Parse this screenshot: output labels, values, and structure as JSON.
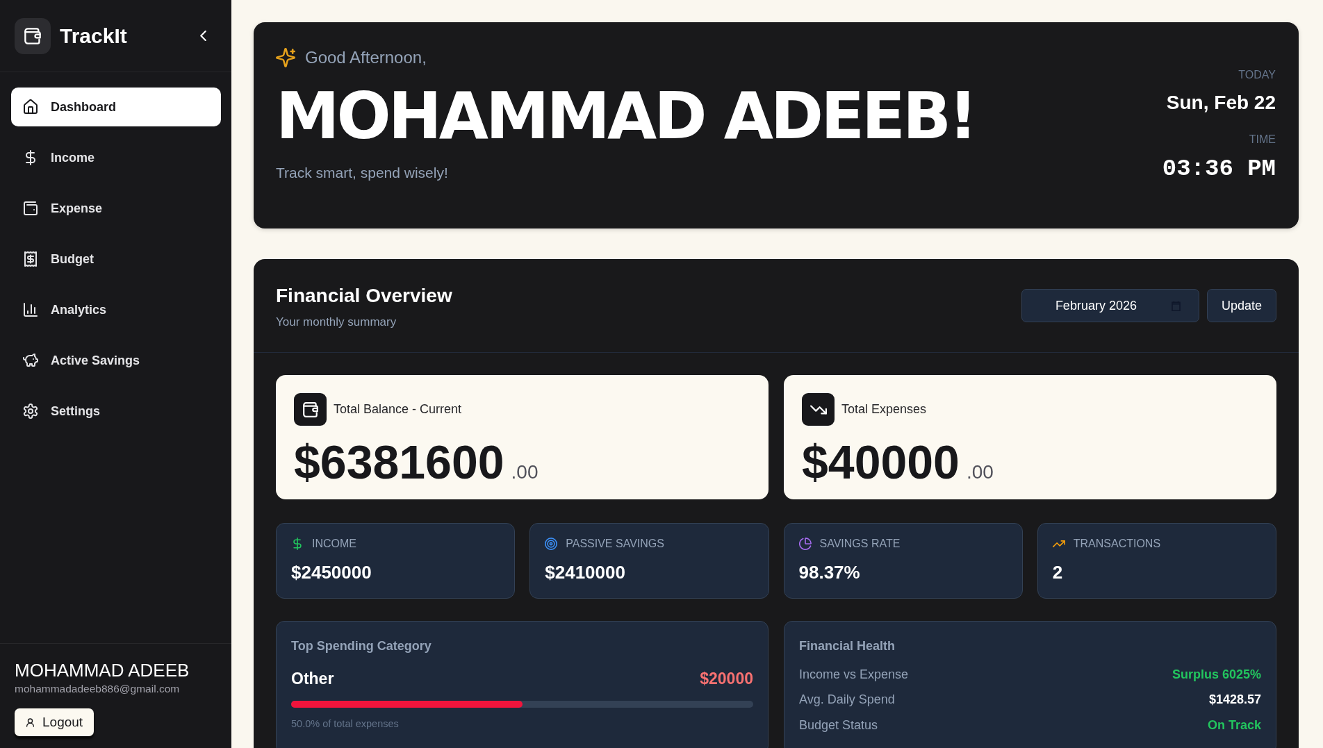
{
  "sidebar": {
    "brand": "TrackIt",
    "nav": [
      {
        "label": "Dashboard",
        "selected": true
      },
      {
        "label": "Income",
        "selected": false
      },
      {
        "label": "Expense",
        "selected": false
      },
      {
        "label": "Budget",
        "selected": false
      },
      {
        "label": "Analytics",
        "selected": false
      },
      {
        "label": "Active Savings",
        "selected": false
      },
      {
        "label": "Settings",
        "selected": false
      }
    ],
    "user": {
      "name": "MOHAMMAD ADEEB",
      "email": "mohammadadeeb886@gmail.com"
    },
    "logout_button": "Logout"
  },
  "greeting": {
    "salutation": "Good Afternoon,",
    "name": "MOHAMMAD ADEEB!",
    "tagline": "Track smart, spend wisely!",
    "today_label": "TODAY",
    "date": "Sun, Feb 22",
    "time_label": "TIME",
    "time": "03:36 PM"
  },
  "overview": {
    "title": "Financial Overview",
    "subtitle": "Your monthly summary",
    "month_field": {
      "value": "February 2026"
    },
    "update_button": "Update",
    "balance_cards": [
      {
        "label": "Total Balance - Current",
        "amount": "$6381600",
        "cents": ".00"
      },
      {
        "label": "Total Expenses",
        "amount": "$40000",
        "cents": ".00"
      }
    ],
    "stats": [
      {
        "label": "INCOME",
        "value": "$2450000",
        "color": "#22c55e"
      },
      {
        "label": "PASSIVE SAVINGS",
        "value": "$2410000",
        "color": "#3b8ff6"
      },
      {
        "label": "SAVINGS RATE",
        "value": "98.37%",
        "color": "#a66cf0"
      },
      {
        "label": "TRANSACTIONS",
        "value": "2",
        "color": "#f59e0b"
      }
    ],
    "top_spending": {
      "title": "Top Spending Category",
      "category": "Other",
      "amount": "$20000",
      "level": 0.5,
      "note": "50.0% of total expenses"
    },
    "health": {
      "title": "Financial Health",
      "rows": [
        {
          "label": "Income vs Expense",
          "value": "Surplus 6025%",
          "color": "#22c55e"
        },
        {
          "label": "Avg. Daily Spend",
          "value": "$1428.57",
          "color": "#ffffff"
        },
        {
          "label": "Budget Status",
          "value": "On Track",
          "color": "#22c55e"
        }
      ]
    }
  }
}
